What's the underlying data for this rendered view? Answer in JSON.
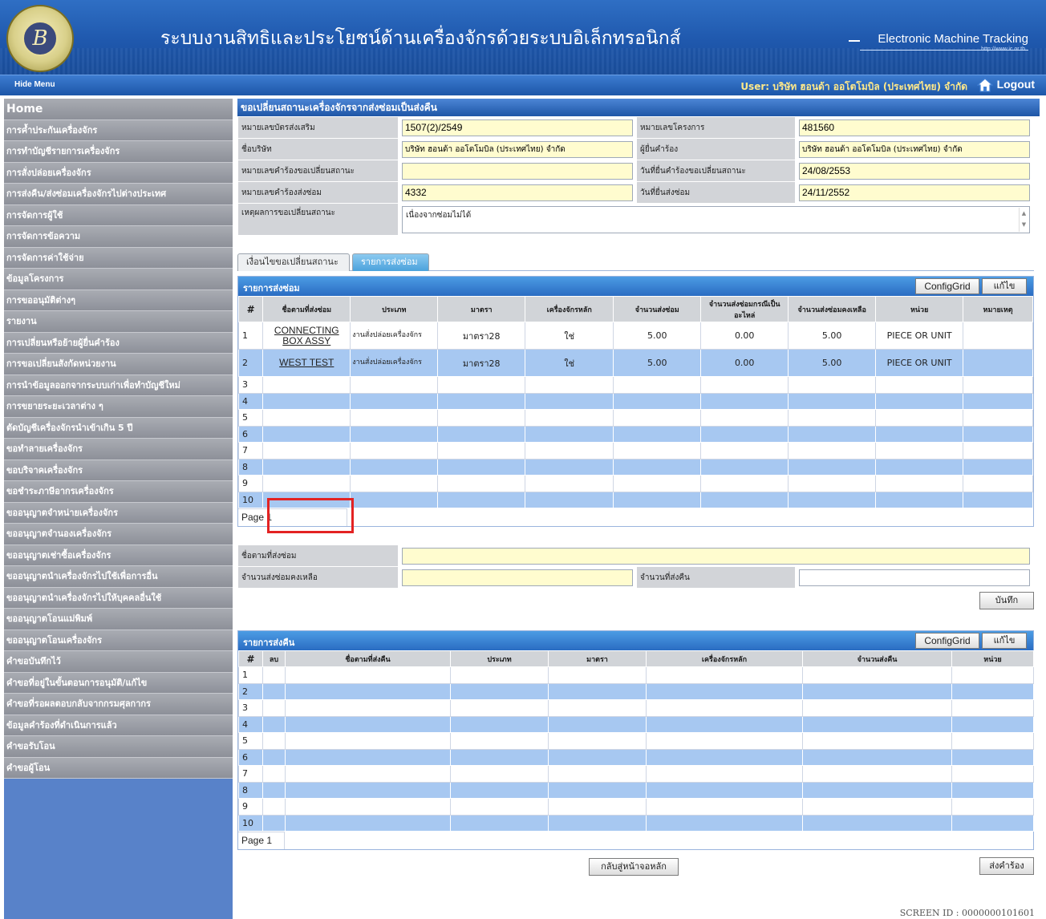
{
  "header": {
    "title_th": "ระบบงานสิทธิและประโยชน์ด้านเครื่องจักรด้วยระบบอิเล็กทรอนิกส์",
    "title_en": "Electronic Machine Tracking",
    "url": "http://www.ic.or.th",
    "logo_letter": "B"
  },
  "topbar": {
    "hide_menu": "Hide Menu",
    "user_label": "User:",
    "user_name": "บริษัท ฮอนด้า ออโตโมบิล (ประเทศไทย) จำกัด",
    "logout": "Logout"
  },
  "sidebar": {
    "items": [
      "Home",
      "การค้ำประกันเครื่องจักร",
      "การทำบัญชีรายการเครื่องจักร",
      "การสั่งปล่อยเครื่องจักร",
      "การส่งคืน/ส่งซ่อมเครื่องจักรไปต่างประเทศ",
      "การจัดการผู้ใช้",
      "การจัดการข้อความ",
      "การจัดการค่าใช้จ่าย",
      "ข้อมูลโครงการ",
      "การขออนุมัติต่างๆ",
      "รายงาน",
      "การเปลี่ยนหรือย้ายผู้ยื่นคำร้อง",
      "การขอเปลี่ยนสังกัดหน่วยงาน",
      "การนำข้อมูลออกจากระบบเก่าเพื่อทำบัญชีใหม่",
      "การขยายระยะเวลาต่าง ๆ",
      "ตัดบัญชีเครื่องจักรนำเข้าเกิน 5 ปี",
      "ขอทำลายเครื่องจักร",
      "ขอบริจาคเครื่องจักร",
      "ขอชำระภาษีอากรเครื่องจักร",
      "ขออนุญาตจำหน่ายเครื่องจักร",
      "ขออนุญาตจำนองเครื่องจักร",
      "ขออนุญาตเช่าซื้อเครื่องจักร",
      "ขออนุญาตนำเครื่องจักรไปใช้เพื่อการอื่น",
      "ขออนุญาตนำเครื่องจักรไปให้บุคคลอื่นใช้",
      "ขออนุญาตโอนแม่พิมพ์",
      "ขออนุญาตโอนเครื่องจักร",
      "คำขอบันทึกไว้",
      "คำขอที่อยู่ในขั้นตอนการอนุมัติ/แก้ไข",
      "คำขอที่รอผลตอบกลับจากกรมศุลกากร",
      "ข้อมูลคำร้องที่ดำเนินการแล้ว",
      "คำขอรับโอน",
      "คำขอผู้โอน"
    ]
  },
  "form": {
    "section_title": "ขอเปลี่ยนสถานะเครื่องจักรจากส่งซ่อมเป็นส่งคืน",
    "promo_card_label": "หมายเลขบัตรส่งเสริม",
    "promo_card_value": "1507(2)/2549",
    "project_no_label": "หมายเลขโครงการ",
    "project_no_value": "481560",
    "company_label": "ชื่อบริษัท",
    "company_value": "บริษัท ฮอนด้า ออโตโมบิล (ประเทศไทย) จำกัด",
    "applicant_label": "ผู้ยื่นคำร้อง",
    "applicant_value": "บริษัท ฮอนด้า ออโตโมบิล (ประเทศไทย) จำกัด",
    "change_req_no_label": "หมายเลขคำร้องขอเปลี่ยนสถานะ",
    "change_req_no_value": "",
    "change_req_date_label": "วันที่ยื่นคำร้องขอเปลี่ยนสถานะ",
    "change_req_date_value": "24/08/2553",
    "repair_req_no_label": "หมายเลขคำร้องส่งซ่อม",
    "repair_req_no_value": "4332",
    "repair_date_label": "วันที่ยื่นส่งซ่อม",
    "repair_date_value": "24/11/2552",
    "reason_label": "เหตุผลการขอเปลี่ยนสถานะ",
    "reason_value": "เนื่องจากซ่อมไม่ได้"
  },
  "tabs": [
    "เงื่อนไขขอเปลี่ยนสถานะ",
    "รายการส่งซ่อม"
  ],
  "repair_grid": {
    "title": "รายการส่งซ่อม",
    "config_label": "ConfigGrid",
    "edit_label": "แก้ไข",
    "columns": [
      "#",
      "ชื่อตามที่ส่งซ่อม",
      "ประเภท",
      "มาตรา",
      "เครื่องจักรหลัก",
      "จำนวนส่งซ่อม",
      "จำนวนส่งซ่อมกรณีเป็นอะไหล่",
      "จำนวนส่งซ่อมคงเหลือ",
      "หน่วย",
      "หมายเหตุ"
    ],
    "rows": [
      {
        "no": "1",
        "name": "CONNECTING BOX ASSY",
        "type": "งานสั่งปล่อยเครื่องจักร",
        "section": "มาตรา28",
        "main": "ใช่",
        "qty": "5.00",
        "spare": "0.00",
        "remain": "5.00",
        "unit": "PIECE OR UNIT",
        "note": ""
      },
      {
        "no": "2",
        "name": "WEST TEST",
        "type": "งานสั่งปล่อยเครื่องจักร",
        "section": "มาตรา28",
        "main": "ใช่",
        "qty": "5.00",
        "spare": "0.00",
        "remain": "5.00",
        "unit": "PIECE OR UNIT",
        "note": ""
      }
    ],
    "empty_rows": [
      "3",
      "4",
      "5",
      "6",
      "7",
      "8",
      "9",
      "10"
    ],
    "pager": "Page 1"
  },
  "detail": {
    "name_label": "ชื่อตามที่ส่งซ่อม",
    "name_value": "",
    "remain_label": "จำนวนส่งซ่อมคงเหลือ",
    "remain_value": "",
    "return_label": "จำนวนที่ส่งคืน",
    "return_value": "",
    "save_label": "บันทึก"
  },
  "return_grid": {
    "title": "รายการส่งคืน",
    "config_label": "ConfigGrid",
    "edit_label": "แก้ไข",
    "columns": [
      "#",
      "ลบ",
      "ชื่อตามที่ส่งคืน",
      "ประเภท",
      "มาตรา",
      "เครื่องจักรหลัก",
      "จำนวนส่งคืน",
      "หน่วย"
    ],
    "rows": [
      "1",
      "2",
      "3",
      "4",
      "5",
      "6",
      "7",
      "8",
      "9",
      "10"
    ],
    "pager": "Page 1"
  },
  "footer": {
    "back_label": "กลับสู่หน้าจอหลัก",
    "submit_label": "ส่งคำร้อง",
    "screen_id": "SCREEN ID :  0000000101601"
  }
}
